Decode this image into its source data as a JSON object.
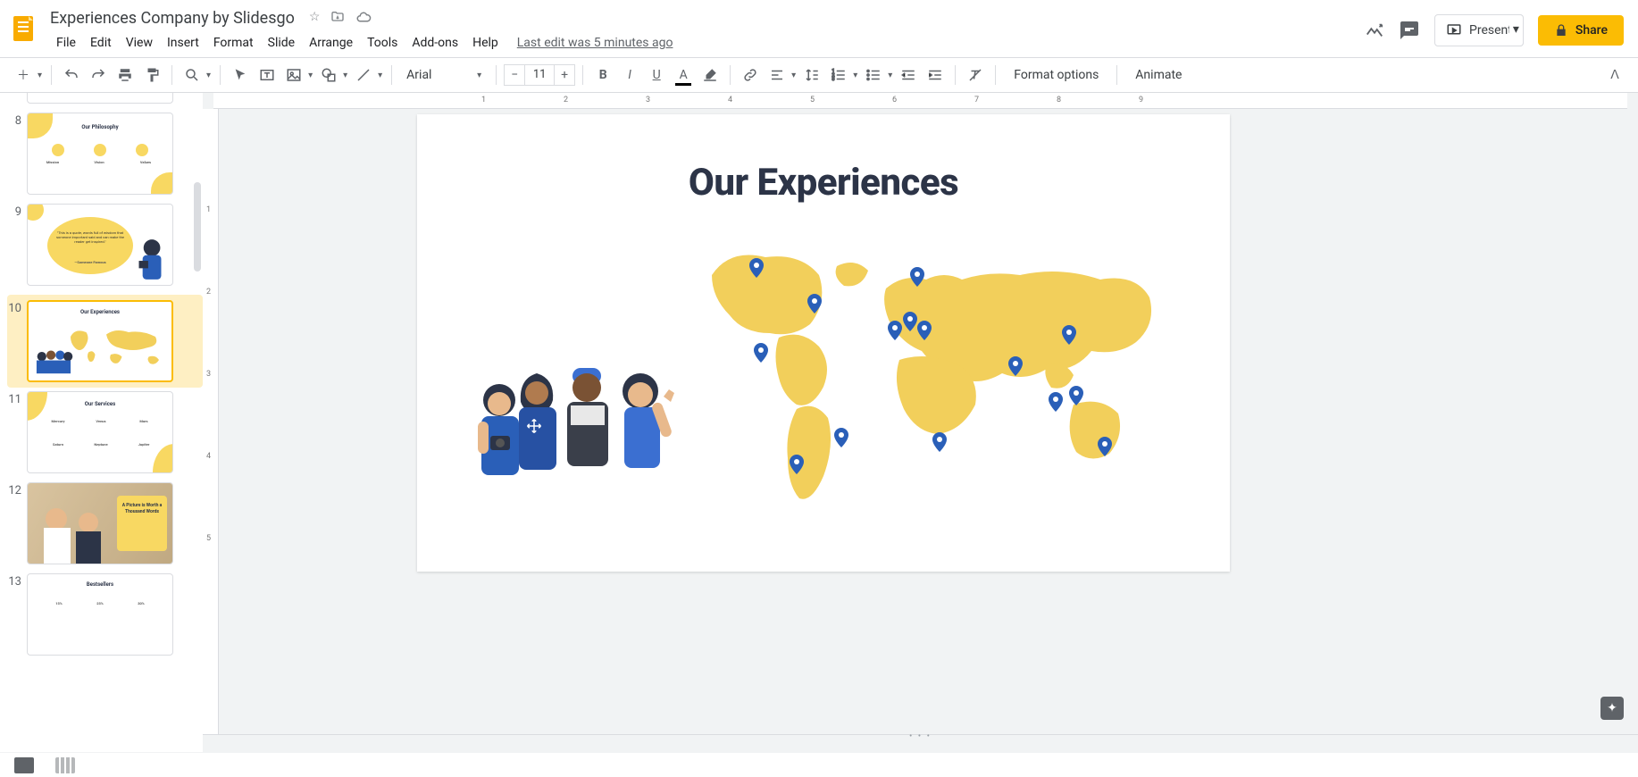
{
  "doc": {
    "title": "Experiences Company by Slidesgo"
  },
  "menubar": {
    "file": "File",
    "edit": "Edit",
    "view": "View",
    "insert": "Insert",
    "format": "Format",
    "slide": "Slide",
    "arrange": "Arrange",
    "tools": "Tools",
    "addons": "Add-ons",
    "help": "Help",
    "last_edit": "Last edit was 5 minutes ago"
  },
  "header_buttons": {
    "present": "Present",
    "share": "Share"
  },
  "toolbar": {
    "font_family": "Arial",
    "font_size": "11",
    "format_options": "Format options",
    "animate": "Animate"
  },
  "filmstrip": {
    "active_index": 10,
    "slides": [
      {
        "num": "8",
        "title": "Our Philosophy",
        "cols": [
          "Mission",
          "Vision",
          "Values"
        ]
      },
      {
        "num": "9",
        "quote": "\"This is a quote, words full of wisdom that someone important said and can make the reader get inspired.\"",
        "attrib": "—Someone Famous"
      },
      {
        "num": "10",
        "title": "Our Experiences"
      },
      {
        "num": "11",
        "title": "Our Services",
        "row1": [
          "Mercury",
          "Venus",
          "Mars"
        ],
        "row2": [
          "Saturn",
          "Neptune",
          "Jupiter"
        ]
      },
      {
        "num": "12",
        "caption": "A Picture is Worth a Thousand Words"
      },
      {
        "num": "13",
        "title": "Bestsellers",
        "pcts": [
          "15%",
          "25%",
          "30%"
        ]
      }
    ]
  },
  "slide": {
    "title": "Our Experiences"
  },
  "ruler_h": [
    "1",
    "2",
    "3",
    "4",
    "5",
    "6",
    "7",
    "8",
    "9"
  ],
  "ruler_v": [
    "1",
    "2",
    "3",
    "4",
    "5"
  ]
}
